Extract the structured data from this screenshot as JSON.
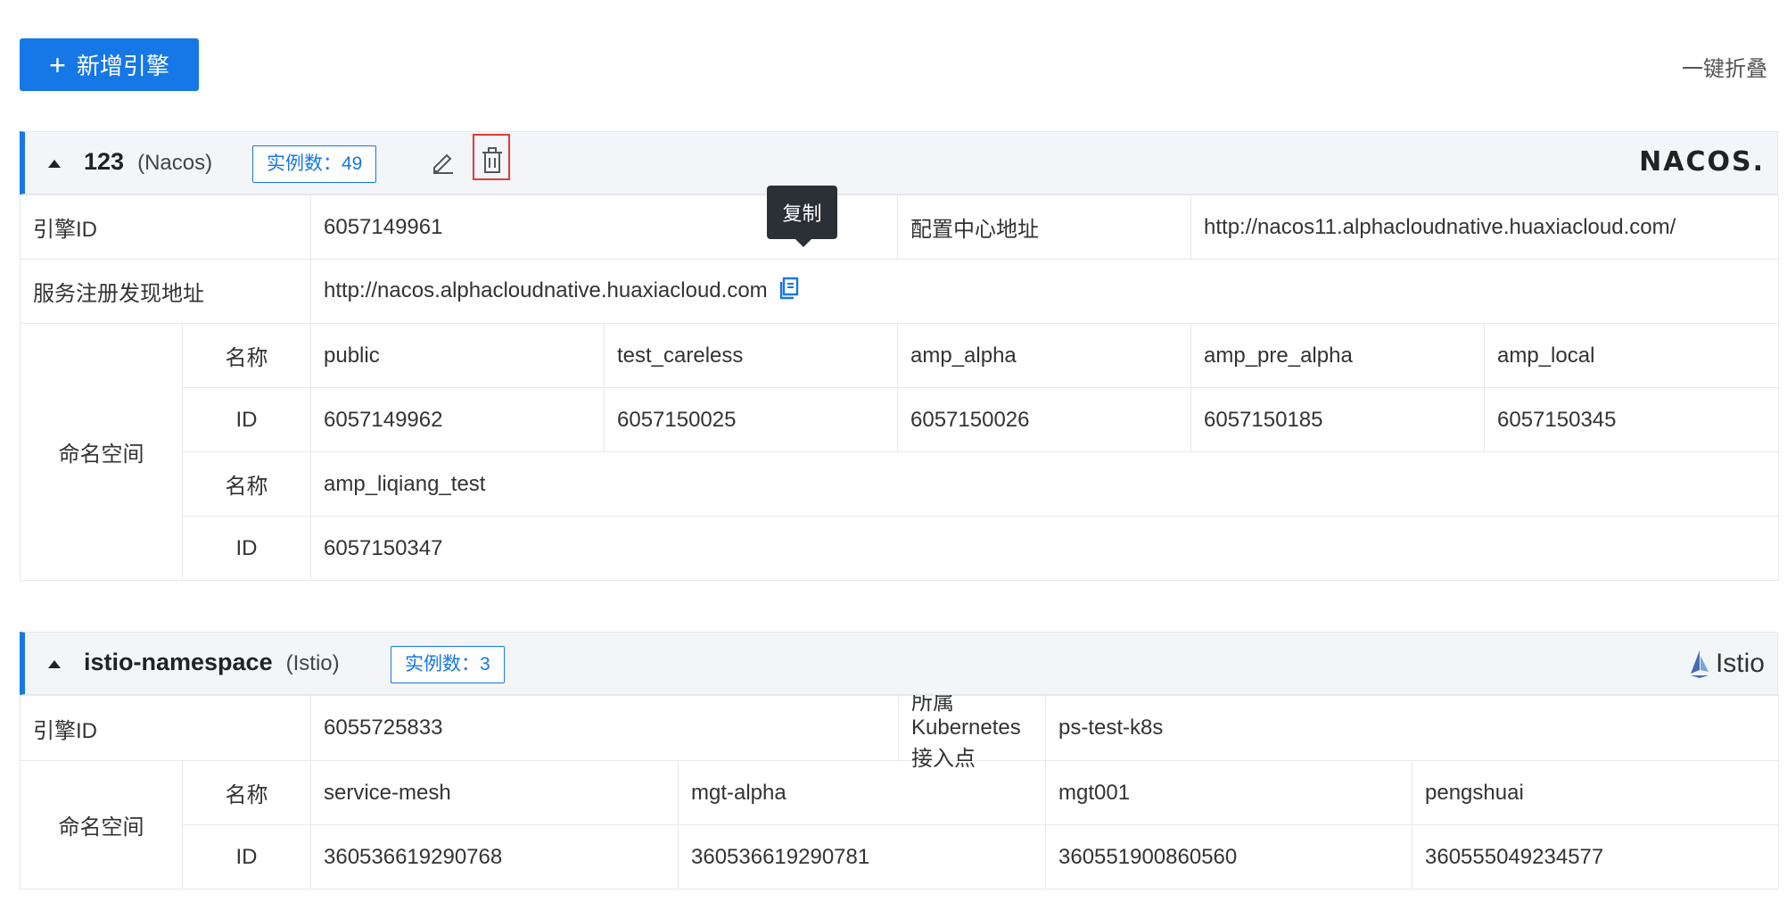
{
  "toolbar": {
    "add_label": "新增引擎",
    "collapse_all_label": "一键折叠"
  },
  "tooltip": {
    "text": "复制"
  },
  "engines": [
    {
      "name": "123",
      "type": "(Nacos)",
      "instances_badge": "实例数：49",
      "logo_text": "NACOS.",
      "engine_id_label": "引擎ID",
      "engine_id": "6057149961",
      "config_center_label": "配置中心地址",
      "config_center": "http://nacos11.alphacloudnative.huaxiacloud.com/",
      "registry_label": "服务注册发现地址",
      "registry": "http://nacos.alphacloudnative.huaxiacloud.com",
      "ns_label": "命名空间",
      "name_label": "名称",
      "id_label": "ID",
      "namespaces_row1": {
        "names": [
          "public",
          "test_careless",
          "amp_alpha",
          "amp_pre_alpha",
          "amp_local"
        ],
        "ids": [
          "6057149962",
          "6057150025",
          "6057150026",
          "6057150185",
          "6057150345"
        ]
      },
      "namespaces_row2": {
        "names": [
          "amp_liqiang_test"
        ],
        "ids": [
          "6057150347"
        ]
      }
    },
    {
      "name": "istio-namespace",
      "type": "(Istio)",
      "instances_badge": "实例数：3",
      "logo_text": "Istio",
      "engine_id_label": "引擎ID",
      "engine_id": "6055725833",
      "k8s_label": "所属Kubernetes接入点",
      "k8s": "ps-test-k8s",
      "ns_label": "命名空间",
      "name_label": "名称",
      "id_label": "ID",
      "namespaces": {
        "names": [
          "service-mesh",
          "mgt-alpha",
          "mgt001",
          "pengshuai"
        ],
        "ids": [
          "360536619290768",
          "360536619290781",
          "360551900860560",
          "360555049234577"
        ]
      }
    }
  ],
  "colors": {
    "primary": "#1677e6",
    "danger": "#e53935",
    "header_bg": "#f3f5f9"
  }
}
